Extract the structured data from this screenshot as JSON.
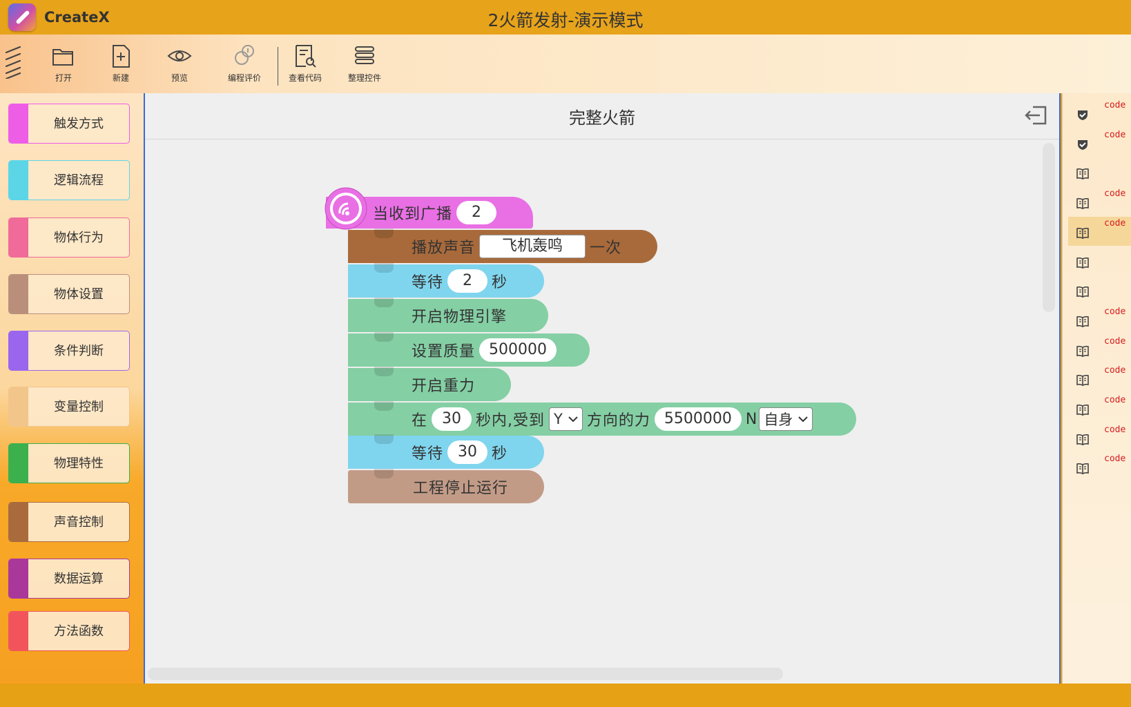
{
  "titlebar": {
    "app_name": "CreateX",
    "window_title": "2火箭发射-演示模式"
  },
  "toolbar": {
    "open": "打开",
    "new": "新建",
    "preview": "预览",
    "review": "编程评价",
    "view_code": "查看代码",
    "tidy": "整理控件"
  },
  "categories": [
    {
      "label": "触发方式",
      "color": "#ee5de6"
    },
    {
      "label": "逻辑流程",
      "color": "#5cd5e6"
    },
    {
      "label": "物体行为",
      "color": "#f06a9a"
    },
    {
      "label": "物体设置",
      "color": "#b98f7c"
    },
    {
      "label": "条件判断",
      "color": "#9b66ee"
    },
    {
      "label": "变量控制",
      "color": "#f2c58a"
    },
    {
      "label": "物理特性",
      "color": "#3bb04c"
    },
    {
      "label": "声音控制",
      "color": "#a96b3c"
    },
    {
      "label": "数据运算",
      "color": "#a9389a"
    },
    {
      "label": "方法函数",
      "color": "#f2545b"
    }
  ],
  "workspace": {
    "title": "完整火箭",
    "blocks": {
      "hat": {
        "label": "当收到广播",
        "value": "2",
        "color": "#e96fe4"
      },
      "sound": {
        "label": "播放声音",
        "value": "飞机轰鸣",
        "suffix": "一次",
        "color": "#a86a3b"
      },
      "wait1": {
        "label": "等待",
        "value": "2",
        "suffix": "秒",
        "color": "#7fd5ee"
      },
      "physics": {
        "label": "开启物理引擎",
        "color": "#84cfa4"
      },
      "mass": {
        "label": "设置质量",
        "value": "500000",
        "color": "#84cfa4"
      },
      "gravity": {
        "label": "开启重力",
        "color": "#84cfa4"
      },
      "force": {
        "prefix": "在",
        "time": "30",
        "mid": "秒内,受到",
        "axis": "Y",
        "dir_label": "方向的力",
        "force_value": "5500000",
        "unit": "N",
        "frame": "自身",
        "color": "#84cfa4"
      },
      "wait2": {
        "label": "等待",
        "value": "30",
        "suffix": "秒",
        "color": "#7fd5ee"
      },
      "stop": {
        "label": "工程停止运行",
        "color": "#c29b87"
      }
    }
  },
  "right_panel": {
    "code_label": "code",
    "rows": [
      {
        "icon": "shield-check-icon",
        "has_code": true,
        "selected": false
      },
      {
        "icon": "shield-check-icon",
        "has_code": true,
        "selected": false
      },
      {
        "icon": "book-icon",
        "has_code": false,
        "selected": false
      },
      {
        "icon": "book-icon",
        "has_code": true,
        "selected": false
      },
      {
        "icon": "book-icon",
        "has_code": true,
        "selected": true
      },
      {
        "icon": "book-icon",
        "has_code": false,
        "selected": false
      },
      {
        "icon": "book-icon",
        "has_code": false,
        "selected": false
      },
      {
        "icon": "book-icon",
        "has_code": true,
        "selected": false
      },
      {
        "icon": "book-icon",
        "has_code": true,
        "selected": false
      },
      {
        "icon": "book-icon",
        "has_code": true,
        "selected": false
      },
      {
        "icon": "book-icon",
        "has_code": true,
        "selected": false
      },
      {
        "icon": "book-icon",
        "has_code": true,
        "selected": false
      },
      {
        "icon": "book-icon",
        "has_code": true,
        "selected": false
      }
    ]
  }
}
